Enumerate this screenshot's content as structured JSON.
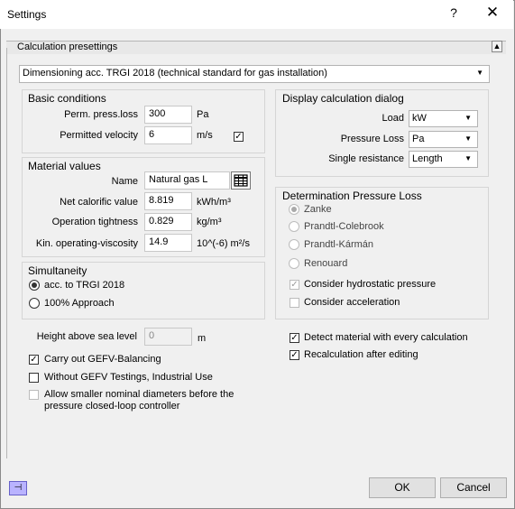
{
  "window": {
    "title": "Settings",
    "help": "?",
    "close": "✕"
  },
  "section": {
    "title": "Calculation presettings",
    "collapse_arrow": "▲"
  },
  "standard_select": {
    "value": "Dimensioning acc. TRGI 2018 (technical standard for gas installation)"
  },
  "basic": {
    "title": "Basic conditions",
    "press_label": "Perm. press.loss",
    "press_value": "300",
    "press_unit": "Pa",
    "vel_label": "Permitted velocity",
    "vel_value": "6",
    "vel_unit": "m/s",
    "vel_checked": "✓"
  },
  "material": {
    "title": "Material values",
    "name_label": "Name",
    "name_value": "Natural gas L",
    "ncv_label": "Net calorific value",
    "ncv_value": "8.819",
    "ncv_unit": "kWh/m³",
    "ot_label": "Operation tightness",
    "ot_value": "0.829",
    "ot_unit": "kg/m³",
    "visc_label": "Kin. operating-viscosity",
    "visc_value": "14.9",
    "visc_unit": "10^(-6) m²/s"
  },
  "simultaneity": {
    "title": "Simultaneity",
    "opt1": "acc. to TRGI 2018",
    "opt2": "100% Approach"
  },
  "display": {
    "title": "Display calculation dialog",
    "load_label": "Load",
    "load_value": "kW",
    "pl_label": "Pressure Loss",
    "pl_value": "Pa",
    "sr_label": "Single resistance",
    "sr_value": "Length"
  },
  "determination": {
    "title": "Determination Pressure Loss",
    "r1": "Zanke",
    "r2": "Prandtl-Colebrook",
    "r3": "Prandtl-Kármán",
    "r4": "Renouard",
    "c1": "Consider hydrostatic pressure",
    "c2": "Consider acceleration",
    "check": "✓"
  },
  "bottom": {
    "height_label": "Height above sea level",
    "height_value": "0",
    "height_unit": "m",
    "gefv": "Carry out GEFV-Balancing",
    "without": "Without GEFV Testings, Industrial Use",
    "allow1": "Allow smaller nominal diameters before the",
    "allow2": "pressure closed-loop controller",
    "detect": "Detect material with every calculation",
    "recalc": "Recalculation after editing",
    "check": "✓"
  },
  "buttons": {
    "ok": "OK",
    "cancel": "Cancel",
    "pin": "⊣"
  },
  "caret": "▼"
}
